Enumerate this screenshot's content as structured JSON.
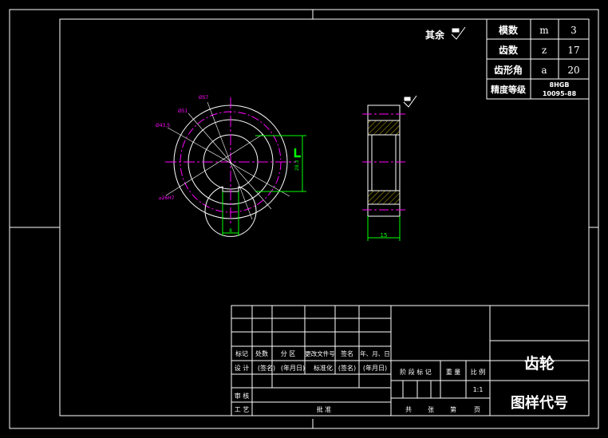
{
  "surface_note": {
    "label": "其余"
  },
  "gear_params": {
    "rows": [
      {
        "name": "模数",
        "symbol": "m",
        "value": "3"
      },
      {
        "name": "齿数",
        "symbol": "z",
        "value": "17"
      },
      {
        "name": "齿形角",
        "symbol": "a",
        "value": "20"
      }
    ],
    "accuracy_label": "精度等级",
    "accuracy_value_line1": "8HGB",
    "accuracy_value_line2": "10095-88"
  },
  "front_view": {
    "dim_outer": "Ø57",
    "dim_pitch": "Ø51",
    "dim_root": "Ø43.5",
    "dim_bore": "⌀26H7",
    "dim_key_width": "8",
    "dim_key_depth": "28.3"
  },
  "side_view": {
    "dim_width": "15"
  },
  "title_block": {
    "part_name": "齿轮",
    "drawing_code_label": "图样代号",
    "rev_headers": [
      "标记",
      "处数",
      "分 区",
      "更改文件号",
      "签名",
      "年、月、日"
    ],
    "design_row": [
      "设 计",
      "(签名)",
      "(年月日)",
      "标准化",
      "(签名)",
      "(年月日)"
    ],
    "review_label": "审 核",
    "process_label": "工 艺",
    "approve_label": "批 准",
    "stage_label": "阶 段 标 记",
    "weight_label": "重 量",
    "scale_label": "比 例",
    "scale_value": "1:1",
    "total_label": "共",
    "sheet_label": "张",
    "page_label": "第",
    "page_suffix": "页"
  },
  "colors": {
    "frame": "#ffffff",
    "center_lines": "#ff00ff",
    "dimension_lines": "#00ff00",
    "hatch": "#c8b400",
    "background": "#000000"
  }
}
